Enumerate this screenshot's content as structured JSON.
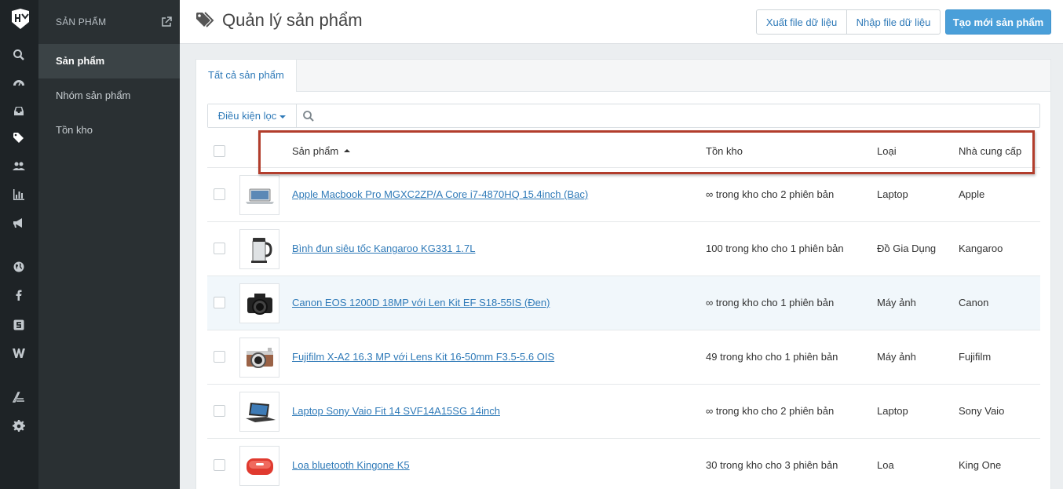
{
  "sidebar": {
    "section_title": "SẢN PHẨM",
    "items": [
      {
        "label": "Sản phẩm",
        "active": true
      },
      {
        "label": "Nhóm sản phẩm",
        "active": false
      },
      {
        "label": "Tồn kho",
        "active": false
      }
    ]
  },
  "header": {
    "title": "Quản lý sản phẩm",
    "export_label": "Xuất file dữ liệu",
    "import_label": "Nhập file dữ liệu",
    "create_label": "Tạo mới sản phẩm"
  },
  "tabs": [
    {
      "label": "Tất cả sản phẩm"
    }
  ],
  "filter": {
    "label": "Điều kiện lọc",
    "search_value": ""
  },
  "table": {
    "columns": {
      "product": "Sản phẩm",
      "stock": "Tồn kho",
      "type": "Loại",
      "vendor": "Nhà cung cấp"
    },
    "rows": [
      {
        "name": "Apple Macbook Pro MGXC2ZP/A Core i7-4870HQ 15.4inch (Bac)",
        "stock": "∞ trong kho cho 2 phiên bản",
        "type": "Laptop",
        "vendor": "Apple",
        "thumb_icon": "laptop-thumbnail"
      },
      {
        "name": "Bình đun siêu tốc Kangaroo KG331 1.7L",
        "stock": "100 trong kho cho 1 phiên bản",
        "type": "Đồ Gia Dụng",
        "vendor": "Kangaroo",
        "thumb_icon": "kettle-thumbnail"
      },
      {
        "name": "Canon EOS 1200D 18MP với Len Kit EF S18-55IS (Đen)",
        "stock": "∞ trong kho cho 1 phiên bản",
        "type": "Máy ảnh",
        "vendor": "Canon",
        "thumb_icon": "camera-thumbnail"
      },
      {
        "name": "Fujifilm X-A2 16.3 MP với Lens Kit 16-50mm F3.5-5.6 OIS",
        "stock": "49 trong kho cho 1 phiên bản",
        "type": "Máy ảnh",
        "vendor": "Fujifilm",
        "thumb_icon": "camera-thumbnail"
      },
      {
        "name": "Laptop Sony Vaio Fit 14 SVF14A15SG 14inch",
        "stock": "∞ trong kho cho 2 phiên bản",
        "type": "Laptop",
        "vendor": "Sony Vaio",
        "thumb_icon": "laptop-thumbnail"
      },
      {
        "name": "Loa bluetooth Kingone K5",
        "stock": "30 trong kho cho 3 phiên bản",
        "type": "Loa",
        "vendor": "King One",
        "thumb_icon": "speaker-thumbnail"
      }
    ]
  },
  "rail_icons": [
    "search-icon",
    "dashboard-icon",
    "inbox-icon",
    "tag-icon",
    "users-icon",
    "chart-icon",
    "megaphone-icon",
    "globe-icon",
    "facebook-icon",
    "s-icon",
    "w-icon",
    "apps-icon",
    "gear-icon"
  ],
  "colors": {
    "rail": "#1e2326",
    "submenu": "#2a3033",
    "accent": "#4a9fd9",
    "link": "#2f7ab8",
    "highlight_box": "#b23d2c"
  }
}
